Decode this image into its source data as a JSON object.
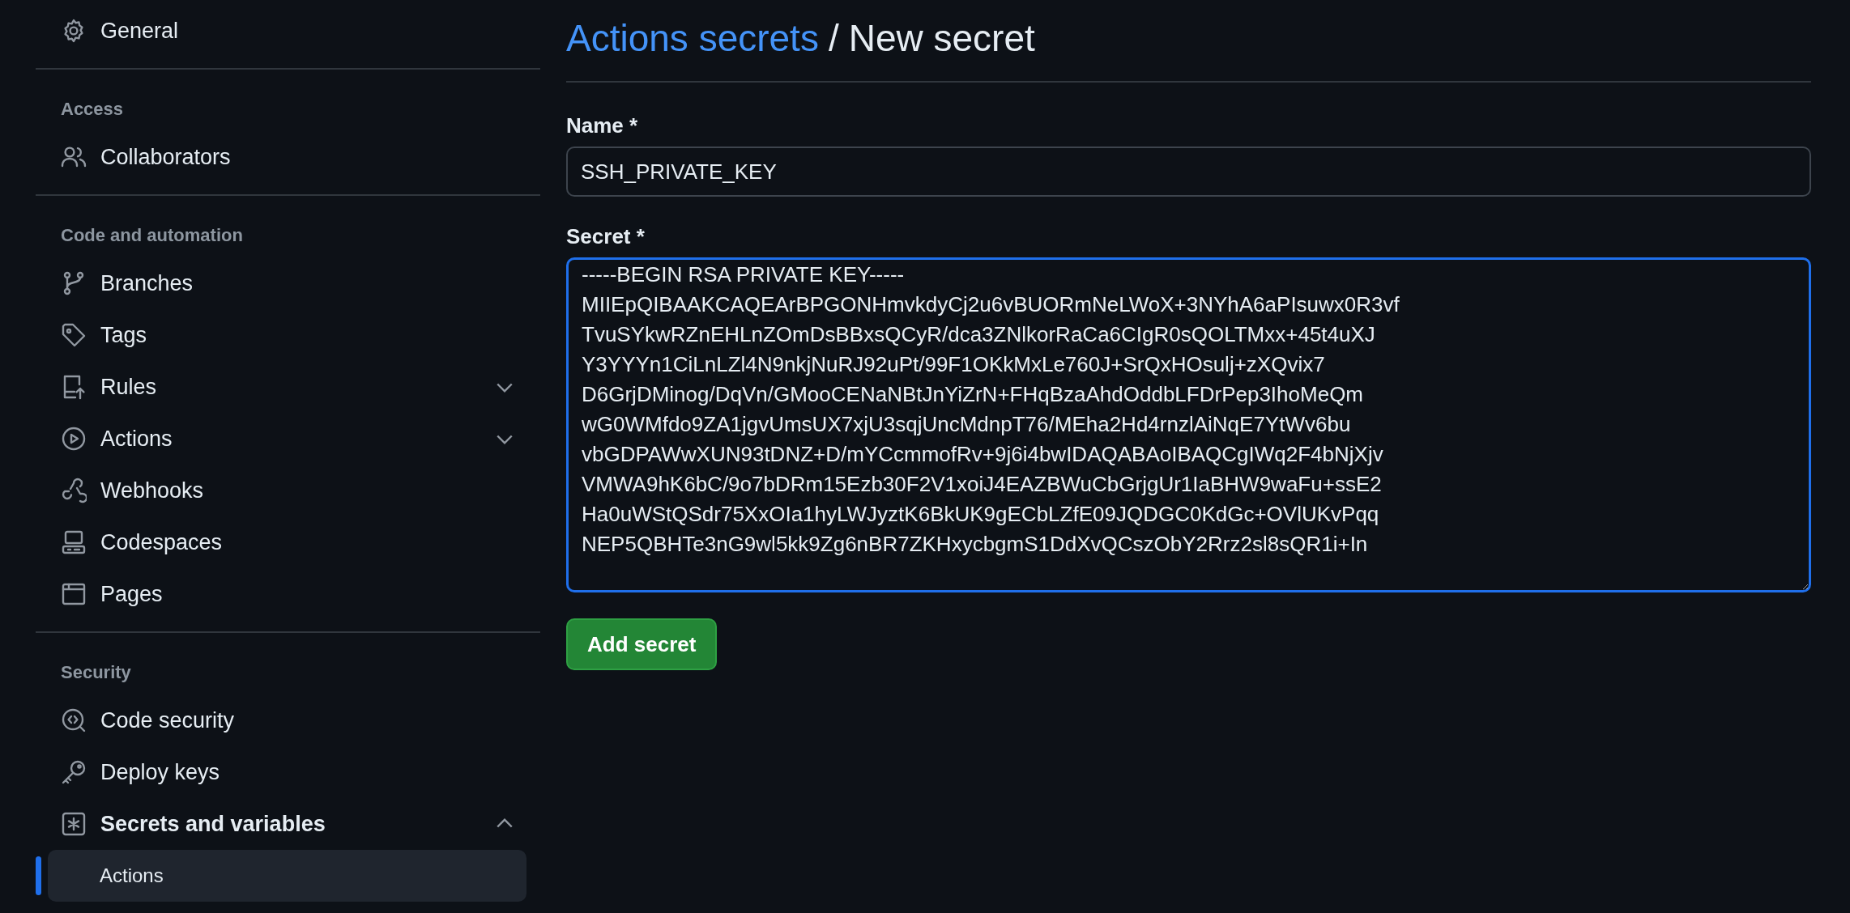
{
  "sidebar": {
    "sections": [
      {
        "items": [
          {
            "label": "General",
            "selected": false
          }
        ]
      },
      {
        "heading": "Access",
        "items": [
          {
            "label": "Collaborators",
            "selected": false
          }
        ]
      },
      {
        "heading": "Code and automation",
        "items": [
          {
            "label": "Branches",
            "selected": false
          },
          {
            "label": "Tags",
            "selected": false
          },
          {
            "label": "Rules",
            "selected": false,
            "expanded": false
          },
          {
            "label": "Actions",
            "selected": false,
            "expanded": false
          },
          {
            "label": "Webhooks",
            "selected": false
          },
          {
            "label": "Codespaces",
            "selected": false
          },
          {
            "label": "Pages",
            "selected": false
          }
        ]
      },
      {
        "heading": "Security",
        "items": [
          {
            "label": "Code security",
            "selected": false
          },
          {
            "label": "Deploy keys",
            "selected": false
          },
          {
            "label": "Secrets and variables",
            "selected": false,
            "expanded": true,
            "children": [
              {
                "label": "Actions",
                "selected": true
              }
            ]
          }
        ]
      }
    ]
  },
  "breadcrumb": {
    "link": "Actions secrets",
    "separator": "/",
    "current": "New secret"
  },
  "form": {
    "name_label": "Name *",
    "name_value": "SSH_PRIVATE_KEY",
    "secret_label": "Secret *",
    "secret_lines": [
      "-----BEGIN RSA PRIVATE KEY-----",
      "MIIEpQIBAAKCAQEArBPGONHmvkdyCj2u6vBUORmNeLWoX+3NYhA6aPIsuwx0R3vf",
      "TvuSYkwRZnEHLnZOmDsBBxsQCyR/dca3ZNlkorRaCa6CIgR0sQOLTMxx+45t4uXJ",
      "Y3YYYn1CiLnLZl4N9nkjNuRJ92uPt/99F1OKkMxLe760J+SrQxHOsulj+zXQvix7",
      "D6GrjDMinog/DqVn/GMooCENaNBtJnYiZrN+FHqBzaAhdOddbLFDrPep3IhoMeQm",
      "wG0WMfdo9ZA1jgvUmsUX7xjU3sqjUncMdnpT76/MEha2Hd4rnzlAiNqE7YtWv6bu",
      "vbGDPAWwXUN93tDNZ+D/mYCcmmofRv+9j6i4bwIDAQABAoIBAQCgIWq2F4bNjXjv",
      "VMWA9hK6bC/9o7bDRm15Ezb30F2V1xoiJ4EAZBWuCbGrjgUr1IaBHW9waFu+ssE2",
      "Ha0uWStQSdr75XxOIa1hyLWJyztK6BkUK9gECbLZfE09JQDGC0KdGc+OVlUKvPqq",
      "NEP5QBHTe3nG9wl5kk9Zg6nBR7ZKHxycbgmS1DdXvQCszObY2Rrz2sl8sQR1i+In"
    ],
    "button": "Add secret"
  }
}
